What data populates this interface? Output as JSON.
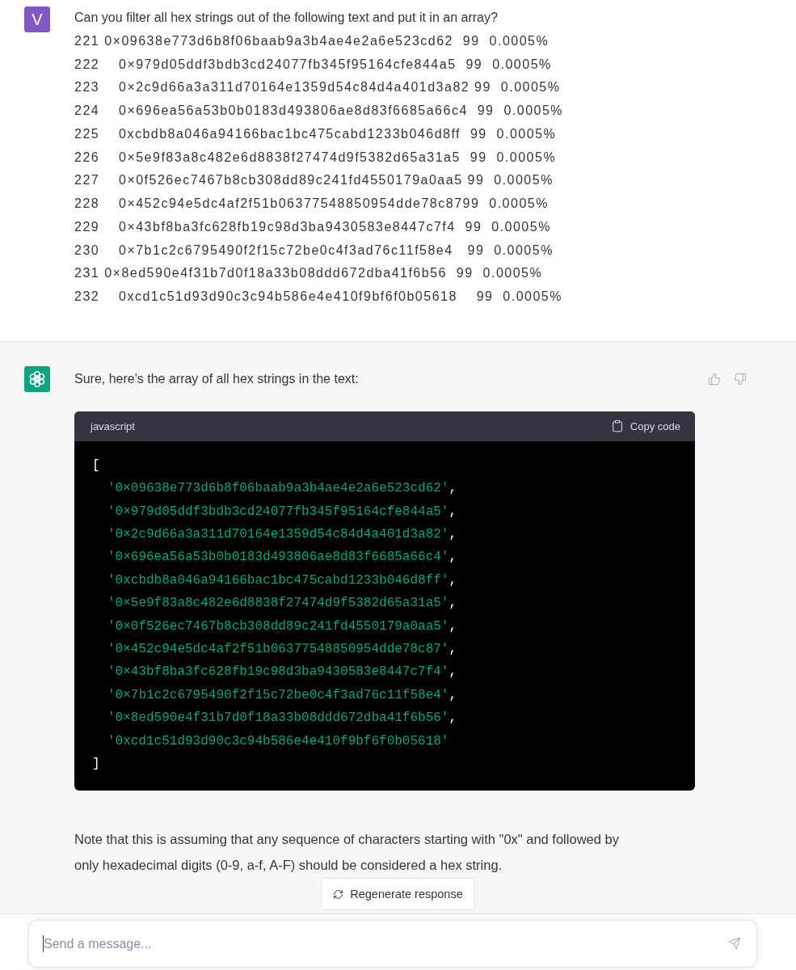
{
  "user_message": {
    "avatar": "V",
    "question": "Can you filter all hex strings out of the following text and put it in an array?",
    "lines": [
      "221 0×09638e773d6b8f06baab9a3b4ae4e2a6e523cd62  99  0.0005%",
      "222    0×979d05ddf3bdb3cd24077fb345f95164cfe844a5  99  0.0005%",
      "223    0×2c9d66a3a311d70164e1359d54c84d4a401d3a82 99  0.0005%",
      "224    0×696ea56a53b0b0183d493806ae8d83f6685a66c4  99  0.0005%",
      "225    0xcbdb8a046a94166bac1bc475cabd1233b046d8ff  99  0.0005%",
      "226    0×5e9f83a8c482e6d8838f27474d9f5382d65a31a5  99  0.0005%",
      "227    0×0f526ec7467b8cb308dd89c241fd4550179a0aa5 99  0.0005%",
      "228    0×452c94e5dc4af2f51b06377548850954dde78c8799  0.0005%",
      "229    0×43bf8ba3fc628fb19c98d3ba9430583e8447c7f4  99  0.0005%",
      "230    0×7b1c2c6795490f2f15c72be0c4f3ad76c11f58e4   99  0.0005%",
      "231 0×8ed590e4f31b7d0f18a33b08ddd672dba41f6b56  99  0.0005%",
      "232    0xcd1c51d93d90c3c94b586e4e410f9bf6f0b05618    99  0.0005%"
    ]
  },
  "assistant_message": {
    "intro": "Sure, here's the array of all hex strings in the text:",
    "code_block": {
      "language": "javascript",
      "copy_label": "Copy code",
      "open": "[",
      "close": "]",
      "items": [
        {
          "value": "'0×09638e773d6b8f06baab9a3b4ae4e2a6e523cd62'",
          "separator": ","
        },
        {
          "value": "'0×979d05ddf3bdb3cd24077fb345f95164cfe844a5'",
          "separator": ","
        },
        {
          "value": "'0×2c9d66a3a311d70164e1359d54c84d4a401d3a82'",
          "separator": ","
        },
        {
          "value": "'0×696ea56a53b0b0183d493806ae8d83f6685a66c4'",
          "separator": ","
        },
        {
          "value": "'0xcbdb8a046a94166bac1bc475cabd1233b046d8ff'",
          "separator": ","
        },
        {
          "value": "'0×5e9f83a8c482e6d8838f27474d9f5382d65a31a5'",
          "separator": ","
        },
        {
          "value": "'0×0f526ec7467b8cb308dd89c241fd4550179a0aa5'",
          "separator": ","
        },
        {
          "value": "'0×452c94e5dc4af2f51b06377548850954dde78c87'",
          "separator": ","
        },
        {
          "value": "'0×43bf8ba3fc628fb19c98d3ba9430583e8447c7f4'",
          "separator": ","
        },
        {
          "value": "'0×7b1c2c6795490f2f15c72be0c4f3ad76c11f58e4'",
          "separator": ","
        },
        {
          "value": "'0×8ed590e4f31b7d0f18a33b08ddd672dba41f6b56'",
          "separator": ","
        },
        {
          "value": "'0xcd1c51d93d90c3c94b586e4e410f9bf6f0b05618'"
        }
      ]
    },
    "note": "Note that this is assuming that any sequence of characters starting with \"0x\" and followed by only hexadecimal digits (0-9, a-f, A-F) should be considered a hex string."
  },
  "regenerate_button": {
    "label": "Regenerate response"
  },
  "composer": {
    "placeholder": "Send a message..."
  }
}
